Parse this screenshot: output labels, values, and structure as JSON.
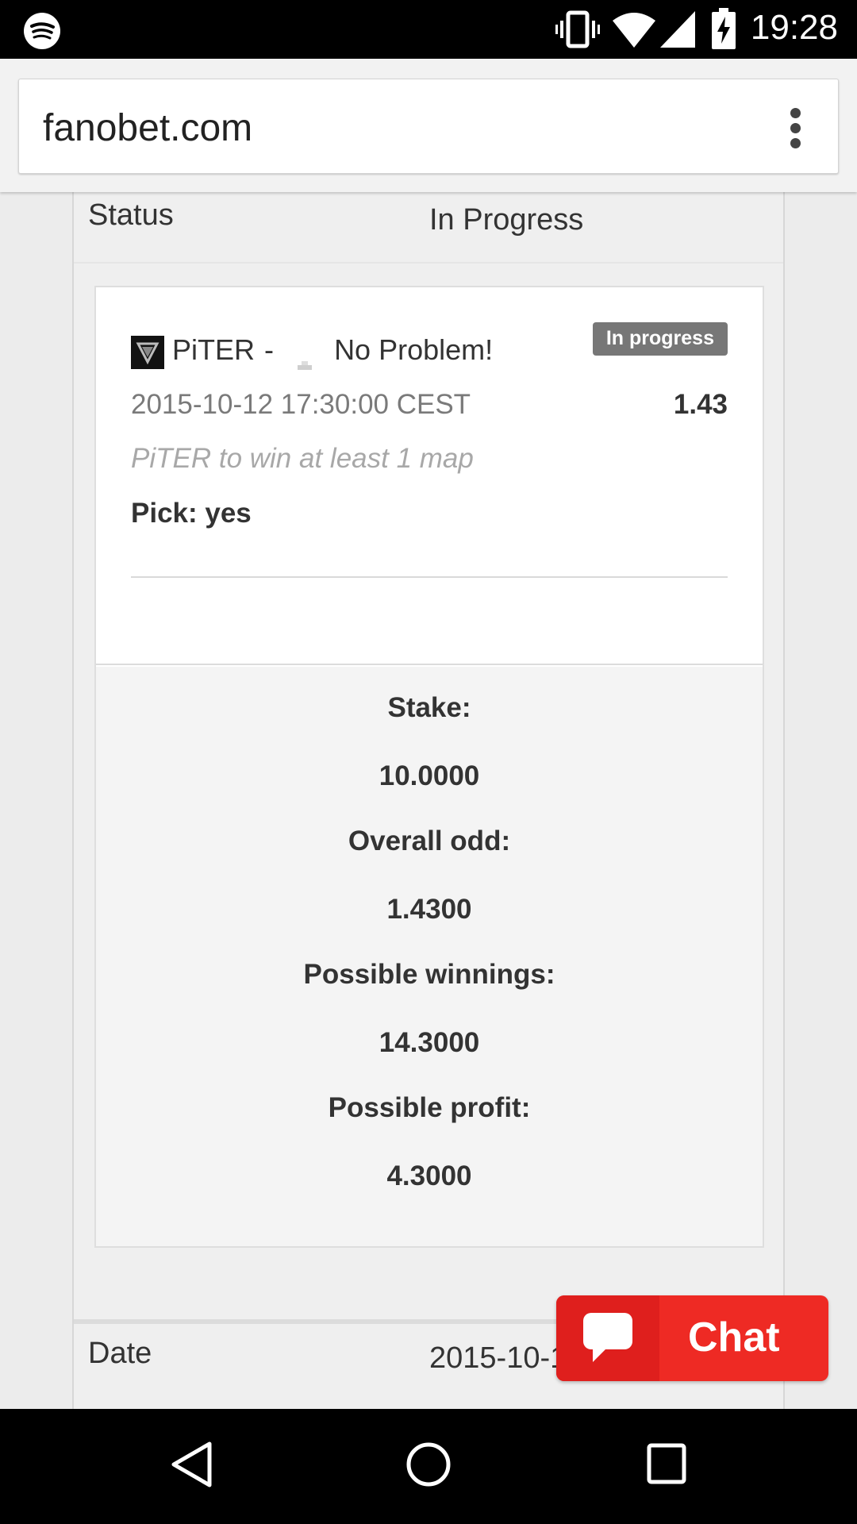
{
  "status_bar": {
    "time": "19:28",
    "icons": [
      "spotify-icon",
      "vibrate-icon",
      "wifi-icon",
      "cell-signal-icon",
      "battery-charging-icon"
    ]
  },
  "browser": {
    "url": "fanobet.com",
    "menu_icon": "more-vert-icon"
  },
  "bet_details": {
    "status_label": "Status",
    "status_value": "In Progress",
    "date_label": "Date",
    "date_value_visible": "2015-10-1"
  },
  "bet_card": {
    "team_a": "PiTER",
    "separator": "-",
    "team_b": "No Problem!",
    "badge": "In progress",
    "match_datetime": "2015-10-12 17:30:00 CEST",
    "odd": "1.43",
    "market": "PiTER to win at least 1 map",
    "pick": "Pick: yes"
  },
  "summary": {
    "stake_label": "Stake:",
    "stake_value": "10.0000",
    "overall_odd_label": "Overall odd:",
    "overall_odd_value": "1.4300",
    "possible_winnings_label": "Possible winnings:",
    "possible_winnings_value": "14.3000",
    "possible_profit_label": "Possible profit:",
    "possible_profit_value": "4.3000"
  },
  "chat": {
    "label": "Chat",
    "icon": "chat-bubble-icon"
  },
  "nav_bar": {
    "icons": [
      "back-icon",
      "home-icon",
      "recents-icon"
    ]
  },
  "colors": {
    "badge_bg": "#777777",
    "chat_red": "#ee2a24",
    "chat_red_dark": "#df1f1d",
    "page_bg": "#ececec"
  }
}
